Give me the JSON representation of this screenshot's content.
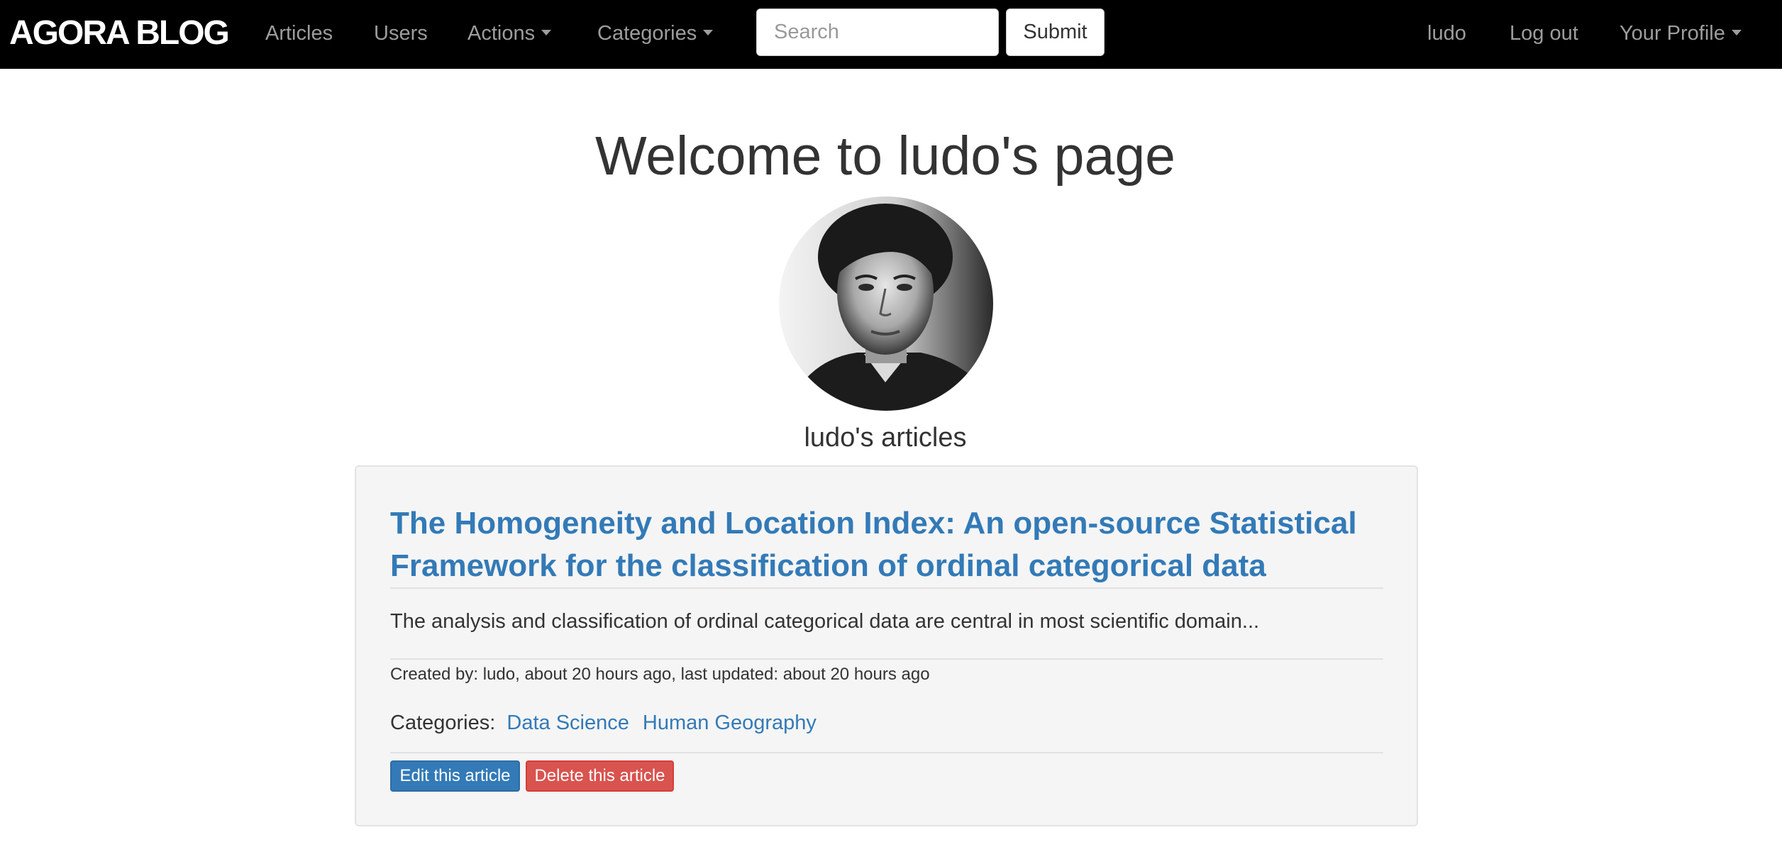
{
  "navbar": {
    "brand": "AGORA BLOG",
    "links": {
      "articles": "Articles",
      "users": "Users",
      "actions": "Actions",
      "categories": "Categories"
    },
    "search": {
      "placeholder": "Search",
      "value": "",
      "submit_label": "Submit"
    },
    "right": {
      "username": "ludo",
      "logout": "Log out",
      "profile": "Your Profile"
    }
  },
  "main": {
    "title": "Welcome to ludo's page",
    "articles_heading": "ludo's articles"
  },
  "article": {
    "title": "The Homogeneity and Location Index: An open-source Statistical Framework for the classification of ordinal categorical data",
    "excerpt": "The analysis and classification of ordinal categorical data are central in most scientific domain...",
    "meta": "Created by: ludo, about 20 hours ago, last updated: about 20 hours ago",
    "categories_label": "Categories:",
    "categories": [
      "Data Science",
      "Human Geography"
    ],
    "edit_label": "Edit this article",
    "delete_label": "Delete this article"
  },
  "colors": {
    "navbar_bg": "#000000",
    "link_blue": "#337ab7",
    "edit_button": "#337ab7",
    "delete_button": "#d9534f",
    "card_bg": "#f5f5f5"
  },
  "icons": [
    "caret-down-icon",
    "avatar-photo"
  ]
}
